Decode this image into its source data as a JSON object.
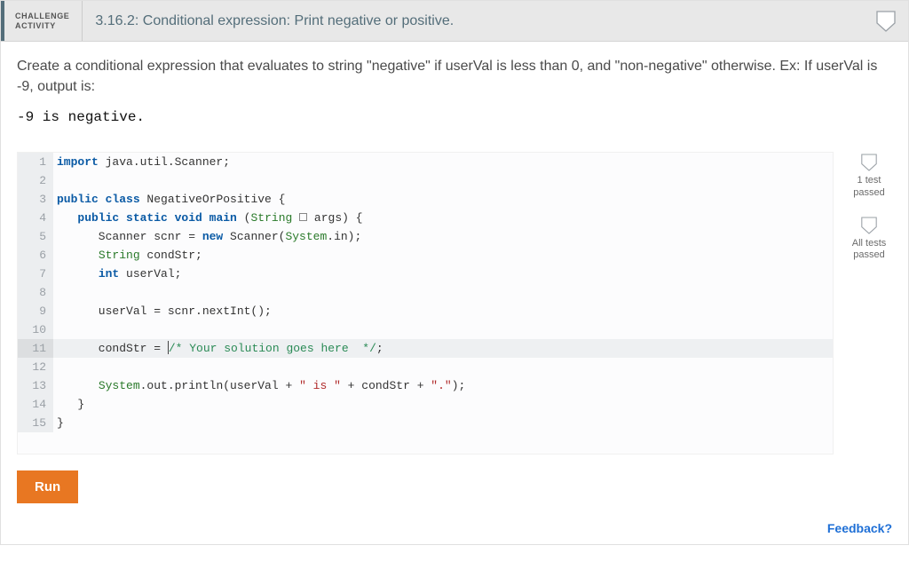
{
  "header": {
    "tag_line1": "CHALLENGE",
    "tag_line2": "ACTIVITY",
    "title": "3.16.2: Conditional expression: Print negative or positive."
  },
  "prompt": "Create a conditional expression that evaluates to string \"negative\" if userVal is less than 0, and \"non-negative\" otherwise. Ex: If userVal is -9, output is:",
  "example_output": "-9 is negative.",
  "code": {
    "active_line": 11,
    "lines": [
      {
        "n": 1,
        "tokens": [
          [
            "kw",
            "import"
          ],
          [
            "p",
            " java.util.Scanner;"
          ]
        ]
      },
      {
        "n": 2,
        "tokens": []
      },
      {
        "n": 3,
        "tokens": [
          [
            "kw",
            "public class"
          ],
          [
            "p",
            " NegativeOrPositive {"
          ]
        ]
      },
      {
        "n": 4,
        "tokens": [
          [
            "p",
            "   "
          ],
          [
            "kw",
            "public static void"
          ],
          [
            "p",
            " "
          ],
          [
            "kw",
            "main"
          ],
          [
            "p",
            " ("
          ],
          [
            "type",
            "String"
          ],
          [
            "p",
            " "
          ],
          [
            "box",
            ""
          ],
          [
            "p",
            " args) {"
          ]
        ]
      },
      {
        "n": 5,
        "tokens": [
          [
            "p",
            "      Scanner scnr = "
          ],
          [
            "kw",
            "new"
          ],
          [
            "p",
            " Scanner("
          ],
          [
            "type",
            "System"
          ],
          [
            "p",
            ".in);"
          ]
        ]
      },
      {
        "n": 6,
        "tokens": [
          [
            "p",
            "      "
          ],
          [
            "type",
            "String"
          ],
          [
            "p",
            " condStr;"
          ]
        ]
      },
      {
        "n": 7,
        "tokens": [
          [
            "p",
            "      "
          ],
          [
            "kw",
            "int"
          ],
          [
            "p",
            " userVal;"
          ]
        ]
      },
      {
        "n": 8,
        "tokens": []
      },
      {
        "n": 9,
        "tokens": [
          [
            "p",
            "      userVal = scnr.nextInt();"
          ]
        ]
      },
      {
        "n": 10,
        "tokens": []
      },
      {
        "n": 11,
        "tokens": [
          [
            "p",
            "      condStr = "
          ],
          [
            "cursor",
            ""
          ],
          [
            "com",
            "/* Your solution goes here  */"
          ],
          [
            "p",
            ";"
          ]
        ]
      },
      {
        "n": 12,
        "tokens": []
      },
      {
        "n": 13,
        "tokens": [
          [
            "p",
            "      "
          ],
          [
            "type",
            "System"
          ],
          [
            "p",
            ".out.println(userVal + "
          ],
          [
            "str",
            "\" is \""
          ],
          [
            "p",
            " + condStr + "
          ],
          [
            "str",
            "\".\""
          ],
          [
            "p",
            ");"
          ]
        ]
      },
      {
        "n": 14,
        "tokens": [
          [
            "p",
            "   }"
          ]
        ]
      },
      {
        "n": 15,
        "tokens": [
          [
            "p",
            "}"
          ]
        ]
      }
    ]
  },
  "badges": [
    {
      "label_line1": "1 test",
      "label_line2": "passed"
    },
    {
      "label_line1": "All tests",
      "label_line2": "passed"
    }
  ],
  "buttons": {
    "run": "Run"
  },
  "feedback_link": "Feedback?"
}
